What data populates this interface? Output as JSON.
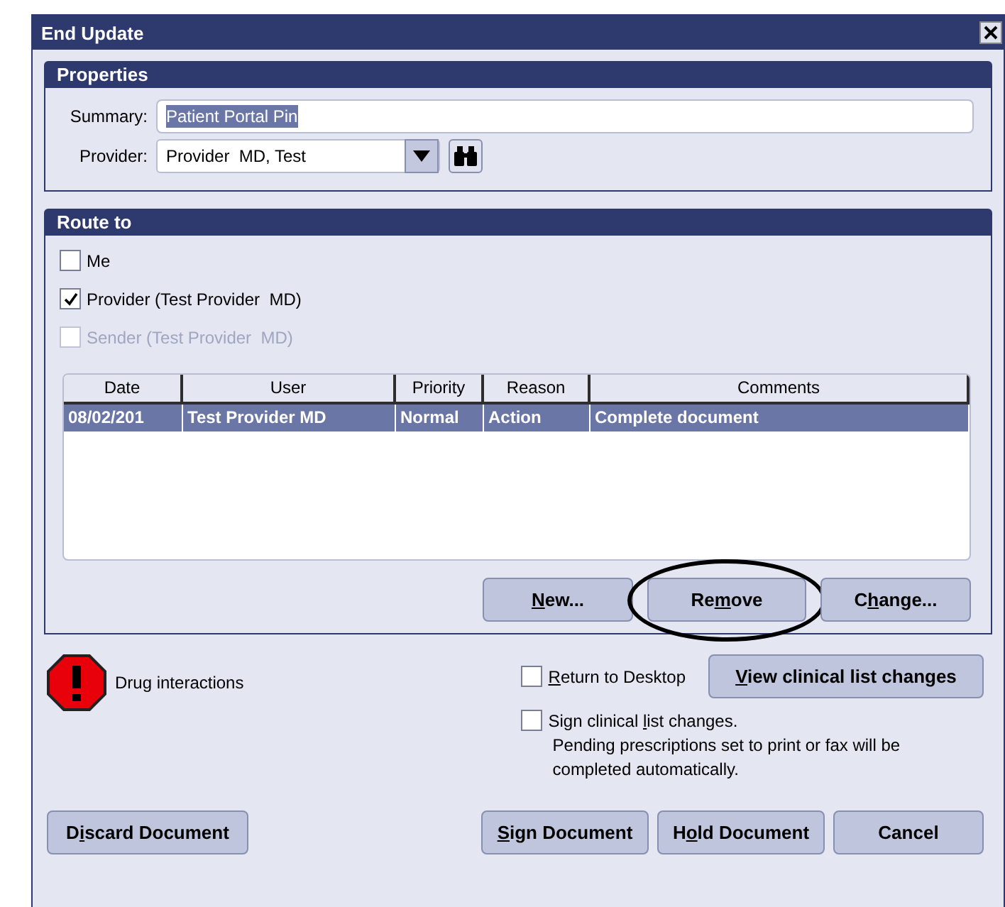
{
  "window": {
    "title": "End Update"
  },
  "properties": {
    "title": "Properties",
    "summary": {
      "label": "Summary:",
      "value": "Patient Portal Pin"
    },
    "provider": {
      "label": "Provider:",
      "value": "Provider  MD, Test"
    }
  },
  "route_to": {
    "title": "Route to",
    "options": [
      {
        "label": "Me",
        "checked": false,
        "disabled": false
      },
      {
        "label": "Provider (Test Provider  MD)",
        "checked": true,
        "disabled": false
      },
      {
        "label": "Sender (Test Provider  MD)",
        "checked": false,
        "disabled": true
      }
    ],
    "table": {
      "columns": [
        "Date",
        "User",
        "Priority",
        "Reason",
        "Comments"
      ],
      "rows": [
        {
          "selected": true,
          "cells": [
            "08/02/201",
            "Test Provider  MD",
            "Normal",
            "Action",
            "Complete document"
          ]
        }
      ]
    },
    "buttons": [
      {
        "key": "N",
        "post": "ew...",
        "circled": false
      },
      {
        "pre": "Re",
        "key": "m",
        "post": "ove",
        "circled": true
      },
      {
        "pre": "C",
        "key": "h",
        "post": "ange...",
        "circled": false
      }
    ]
  },
  "alert": {
    "label": "Drug interactions"
  },
  "return_to_desktop": {
    "key": "R",
    "post": "eturn to Desktop",
    "checked": false
  },
  "view_changes": {
    "key": "V",
    "post": "iew clinical list changes"
  },
  "sign_changes": {
    "pre": "Sign clinical ",
    "key": "l",
    "post": "ist changes.",
    "checked": false
  },
  "note": "Pending prescriptions set to print or fax will be completed automatically.",
  "footer_left": {
    "pre": "D",
    "key": "i",
    "post": "scard Document"
  },
  "footer_buttons": [
    {
      "key": "S",
      "post": "ign Document"
    },
    {
      "pre": "H",
      "key": "o",
      "post": "ld Document"
    },
    {
      "post": "Cancel"
    }
  ]
}
